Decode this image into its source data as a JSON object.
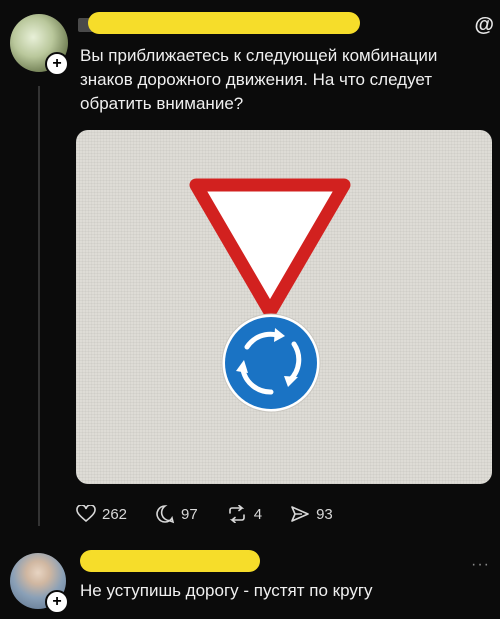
{
  "post": {
    "text": "Вы приближаетесь к следующей комбинации знаков дорожного движения. На что следует обратить внимание?",
    "corner_glyph": "@",
    "image": {
      "description_icons": [
        "yield-sign-icon",
        "roundabout-sign-icon"
      ],
      "colors": {
        "yield_red": "#d2211f",
        "roundabout_blue": "#1a73c4"
      }
    },
    "actions": {
      "likes": "262",
      "comments": "97",
      "reposts": "4",
      "shares": "93"
    }
  },
  "reply": {
    "text": "Не уступишь дорогу - пустят по кругу",
    "more": "···"
  },
  "colors": {
    "background": "#0b0b0b",
    "name_highlight": "#f6dd2a"
  }
}
